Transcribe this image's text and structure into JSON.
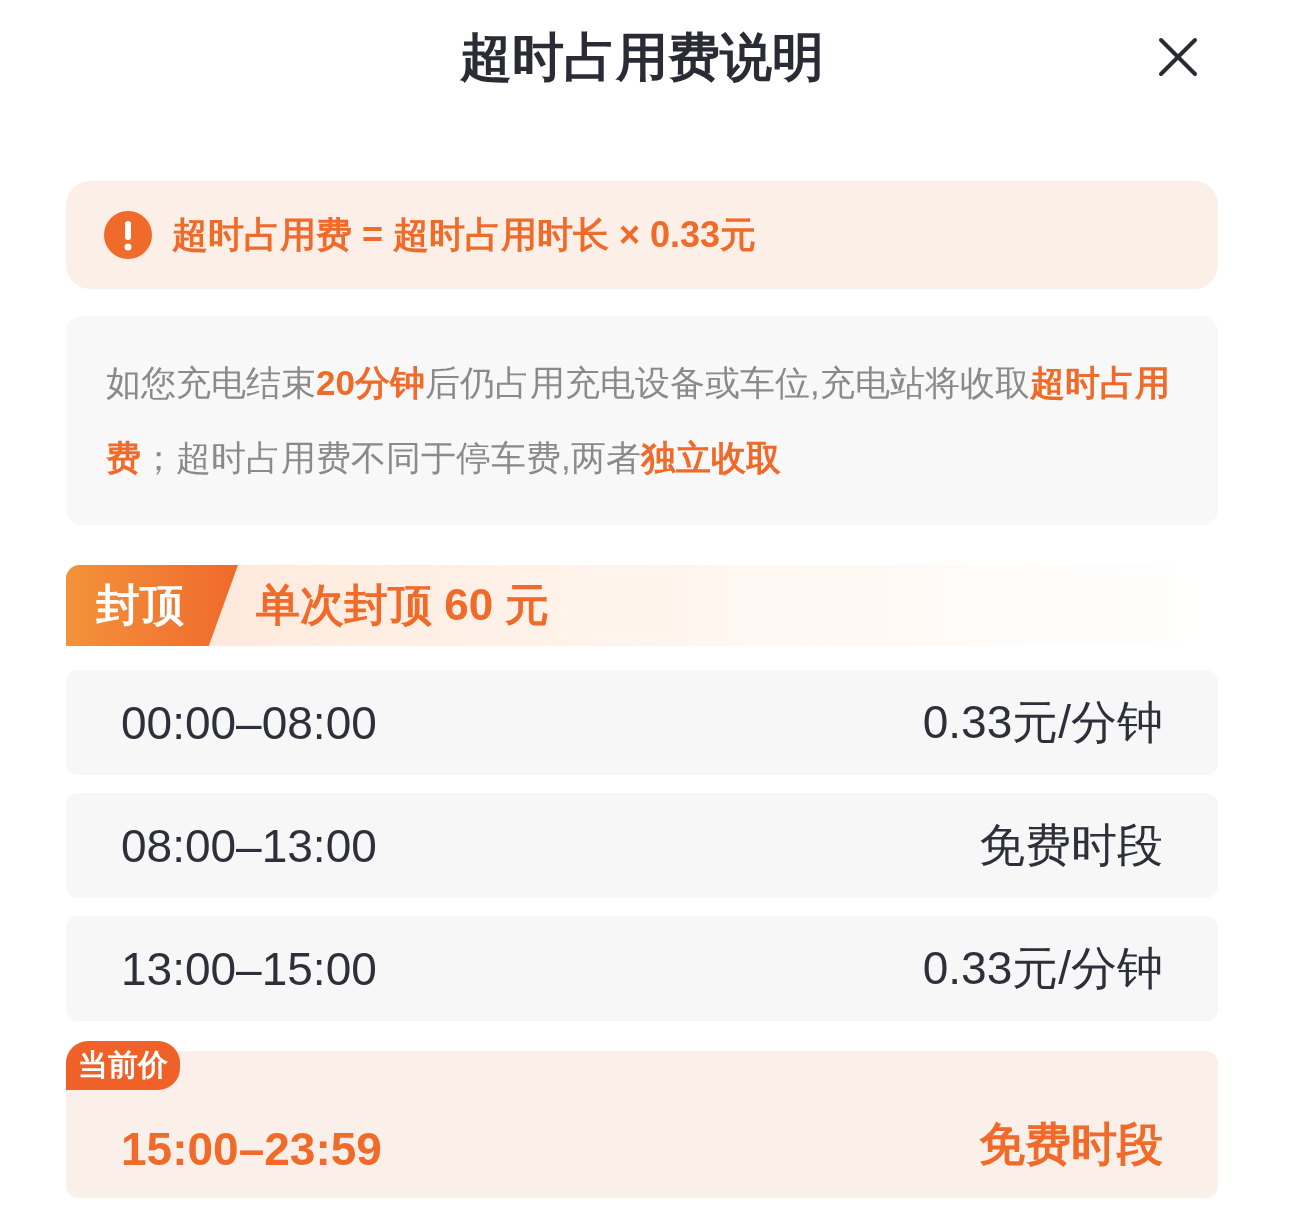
{
  "title": "超时占用费说明",
  "formula": "超时占用费 = 超时占用时长 × 0.33元",
  "description": "如您充电结束**20分钟**后仍占用充电设备或车位,充电站将收取**超时占用费**；超时占用费不同于停车费,两者**独立收取**",
  "cap": {
    "tag": "封顶",
    "text": "单次封顶 60 元"
  },
  "periods": [
    {
      "time": "00:00–08:00",
      "price": "0.33元/分钟",
      "current": false
    },
    {
      "time": "08:00–13:00",
      "price": "免费时段",
      "current": false
    },
    {
      "time": "13:00–15:00",
      "price": "0.33元/分钟",
      "current": false
    },
    {
      "time": "15:00–23:59",
      "price": "免费时段",
      "current": true,
      "badge": "当前价"
    }
  ]
}
